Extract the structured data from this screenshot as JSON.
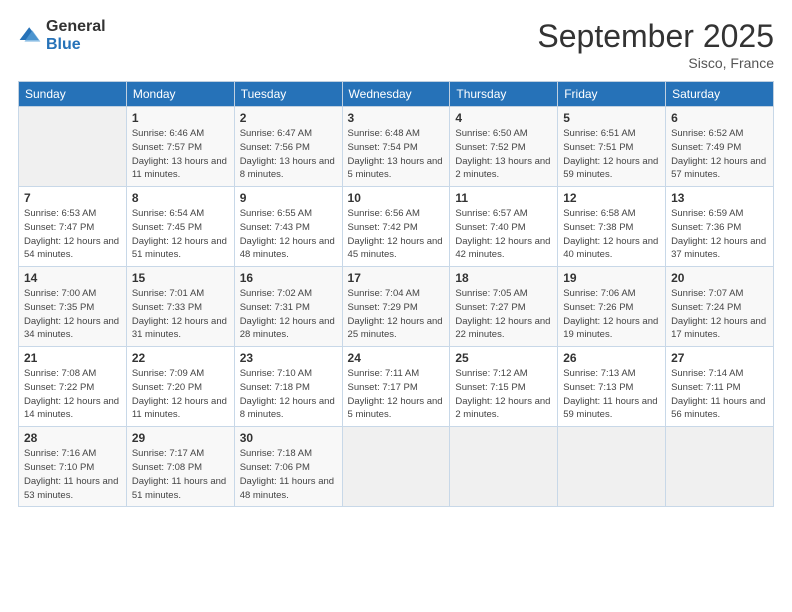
{
  "logo": {
    "general": "General",
    "blue": "Blue"
  },
  "header": {
    "month": "September 2025",
    "location": "Sisco, France"
  },
  "days_of_week": [
    "Sunday",
    "Monday",
    "Tuesday",
    "Wednesday",
    "Thursday",
    "Friday",
    "Saturday"
  ],
  "weeks": [
    [
      {
        "day": "",
        "sunrise": "",
        "sunset": "",
        "daylight": ""
      },
      {
        "day": "1",
        "sunrise": "Sunrise: 6:46 AM",
        "sunset": "Sunset: 7:57 PM",
        "daylight": "Daylight: 13 hours and 11 minutes."
      },
      {
        "day": "2",
        "sunrise": "Sunrise: 6:47 AM",
        "sunset": "Sunset: 7:56 PM",
        "daylight": "Daylight: 13 hours and 8 minutes."
      },
      {
        "day": "3",
        "sunrise": "Sunrise: 6:48 AM",
        "sunset": "Sunset: 7:54 PM",
        "daylight": "Daylight: 13 hours and 5 minutes."
      },
      {
        "day": "4",
        "sunrise": "Sunrise: 6:50 AM",
        "sunset": "Sunset: 7:52 PM",
        "daylight": "Daylight: 13 hours and 2 minutes."
      },
      {
        "day": "5",
        "sunrise": "Sunrise: 6:51 AM",
        "sunset": "Sunset: 7:51 PM",
        "daylight": "Daylight: 12 hours and 59 minutes."
      },
      {
        "day": "6",
        "sunrise": "Sunrise: 6:52 AM",
        "sunset": "Sunset: 7:49 PM",
        "daylight": "Daylight: 12 hours and 57 minutes."
      }
    ],
    [
      {
        "day": "7",
        "sunrise": "Sunrise: 6:53 AM",
        "sunset": "Sunset: 7:47 PM",
        "daylight": "Daylight: 12 hours and 54 minutes."
      },
      {
        "day": "8",
        "sunrise": "Sunrise: 6:54 AM",
        "sunset": "Sunset: 7:45 PM",
        "daylight": "Daylight: 12 hours and 51 minutes."
      },
      {
        "day": "9",
        "sunrise": "Sunrise: 6:55 AM",
        "sunset": "Sunset: 7:43 PM",
        "daylight": "Daylight: 12 hours and 48 minutes."
      },
      {
        "day": "10",
        "sunrise": "Sunrise: 6:56 AM",
        "sunset": "Sunset: 7:42 PM",
        "daylight": "Daylight: 12 hours and 45 minutes."
      },
      {
        "day": "11",
        "sunrise": "Sunrise: 6:57 AM",
        "sunset": "Sunset: 7:40 PM",
        "daylight": "Daylight: 12 hours and 42 minutes."
      },
      {
        "day": "12",
        "sunrise": "Sunrise: 6:58 AM",
        "sunset": "Sunset: 7:38 PM",
        "daylight": "Daylight: 12 hours and 40 minutes."
      },
      {
        "day": "13",
        "sunrise": "Sunrise: 6:59 AM",
        "sunset": "Sunset: 7:36 PM",
        "daylight": "Daylight: 12 hours and 37 minutes."
      }
    ],
    [
      {
        "day": "14",
        "sunrise": "Sunrise: 7:00 AM",
        "sunset": "Sunset: 7:35 PM",
        "daylight": "Daylight: 12 hours and 34 minutes."
      },
      {
        "day": "15",
        "sunrise": "Sunrise: 7:01 AM",
        "sunset": "Sunset: 7:33 PM",
        "daylight": "Daylight: 12 hours and 31 minutes."
      },
      {
        "day": "16",
        "sunrise": "Sunrise: 7:02 AM",
        "sunset": "Sunset: 7:31 PM",
        "daylight": "Daylight: 12 hours and 28 minutes."
      },
      {
        "day": "17",
        "sunrise": "Sunrise: 7:04 AM",
        "sunset": "Sunset: 7:29 PM",
        "daylight": "Daylight: 12 hours and 25 minutes."
      },
      {
        "day": "18",
        "sunrise": "Sunrise: 7:05 AM",
        "sunset": "Sunset: 7:27 PM",
        "daylight": "Daylight: 12 hours and 22 minutes."
      },
      {
        "day": "19",
        "sunrise": "Sunrise: 7:06 AM",
        "sunset": "Sunset: 7:26 PM",
        "daylight": "Daylight: 12 hours and 19 minutes."
      },
      {
        "day": "20",
        "sunrise": "Sunrise: 7:07 AM",
        "sunset": "Sunset: 7:24 PM",
        "daylight": "Daylight: 12 hours and 17 minutes."
      }
    ],
    [
      {
        "day": "21",
        "sunrise": "Sunrise: 7:08 AM",
        "sunset": "Sunset: 7:22 PM",
        "daylight": "Daylight: 12 hours and 14 minutes."
      },
      {
        "day": "22",
        "sunrise": "Sunrise: 7:09 AM",
        "sunset": "Sunset: 7:20 PM",
        "daylight": "Daylight: 12 hours and 11 minutes."
      },
      {
        "day": "23",
        "sunrise": "Sunrise: 7:10 AM",
        "sunset": "Sunset: 7:18 PM",
        "daylight": "Daylight: 12 hours and 8 minutes."
      },
      {
        "day": "24",
        "sunrise": "Sunrise: 7:11 AM",
        "sunset": "Sunset: 7:17 PM",
        "daylight": "Daylight: 12 hours and 5 minutes."
      },
      {
        "day": "25",
        "sunrise": "Sunrise: 7:12 AM",
        "sunset": "Sunset: 7:15 PM",
        "daylight": "Daylight: 12 hours and 2 minutes."
      },
      {
        "day": "26",
        "sunrise": "Sunrise: 7:13 AM",
        "sunset": "Sunset: 7:13 PM",
        "daylight": "Daylight: 11 hours and 59 minutes."
      },
      {
        "day": "27",
        "sunrise": "Sunrise: 7:14 AM",
        "sunset": "Sunset: 7:11 PM",
        "daylight": "Daylight: 11 hours and 56 minutes."
      }
    ],
    [
      {
        "day": "28",
        "sunrise": "Sunrise: 7:16 AM",
        "sunset": "Sunset: 7:10 PM",
        "daylight": "Daylight: 11 hours and 53 minutes."
      },
      {
        "day": "29",
        "sunrise": "Sunrise: 7:17 AM",
        "sunset": "Sunset: 7:08 PM",
        "daylight": "Daylight: 11 hours and 51 minutes."
      },
      {
        "day": "30",
        "sunrise": "Sunrise: 7:18 AM",
        "sunset": "Sunset: 7:06 PM",
        "daylight": "Daylight: 11 hours and 48 minutes."
      },
      {
        "day": "",
        "sunrise": "",
        "sunset": "",
        "daylight": ""
      },
      {
        "day": "",
        "sunrise": "",
        "sunset": "",
        "daylight": ""
      },
      {
        "day": "",
        "sunrise": "",
        "sunset": "",
        "daylight": ""
      },
      {
        "day": "",
        "sunrise": "",
        "sunset": "",
        "daylight": ""
      }
    ]
  ]
}
